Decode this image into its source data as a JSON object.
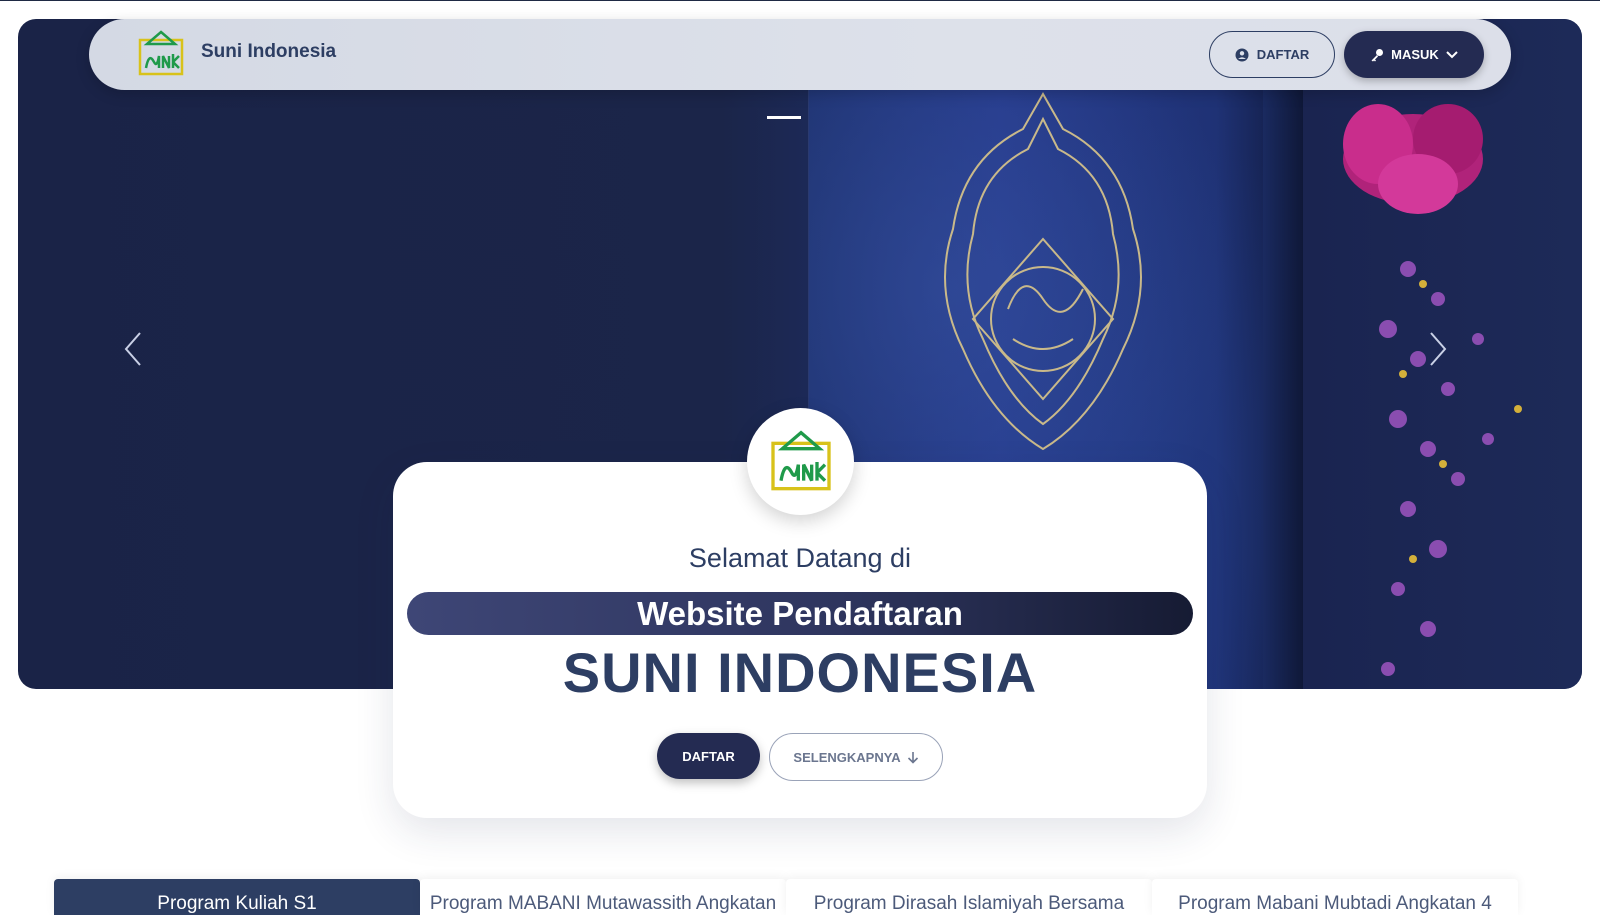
{
  "navbar": {
    "brand_name": "Suni Indonesia",
    "daftar_label": "DAFTAR",
    "masuk_label": "MASUK",
    "icons": [
      "user-circle-icon",
      "key-icon",
      "chevron-down-icon"
    ]
  },
  "hero": {
    "carousel_prev_icon": "chevron-left-icon",
    "carousel_next_icon": "chevron-right-icon"
  },
  "welcome_card": {
    "greeting": "Selamat Datang di",
    "subtitle": "Website Pendaftaran",
    "title": "SUNI INDONESIA",
    "daftar_label": "DAFTAR",
    "more_label": "SELENGKAPNYA",
    "more_icon": "arrow-down-icon"
  },
  "programs": {
    "tabs": [
      {
        "label": "Program Kuliah S1"
      },
      {
        "label": "Program MABANI Mutawassith Angkatan"
      },
      {
        "label": "Program Dirasah Islamiyah Bersama"
      },
      {
        "label": "Program Mabani Mubtadi Angkatan 4"
      }
    ]
  },
  "colors": {
    "primary_navy": "#242b52",
    "text_navy": "#2d3e63",
    "logo_green": "#1f9a4a",
    "logo_yellow": "#d8c21a"
  }
}
